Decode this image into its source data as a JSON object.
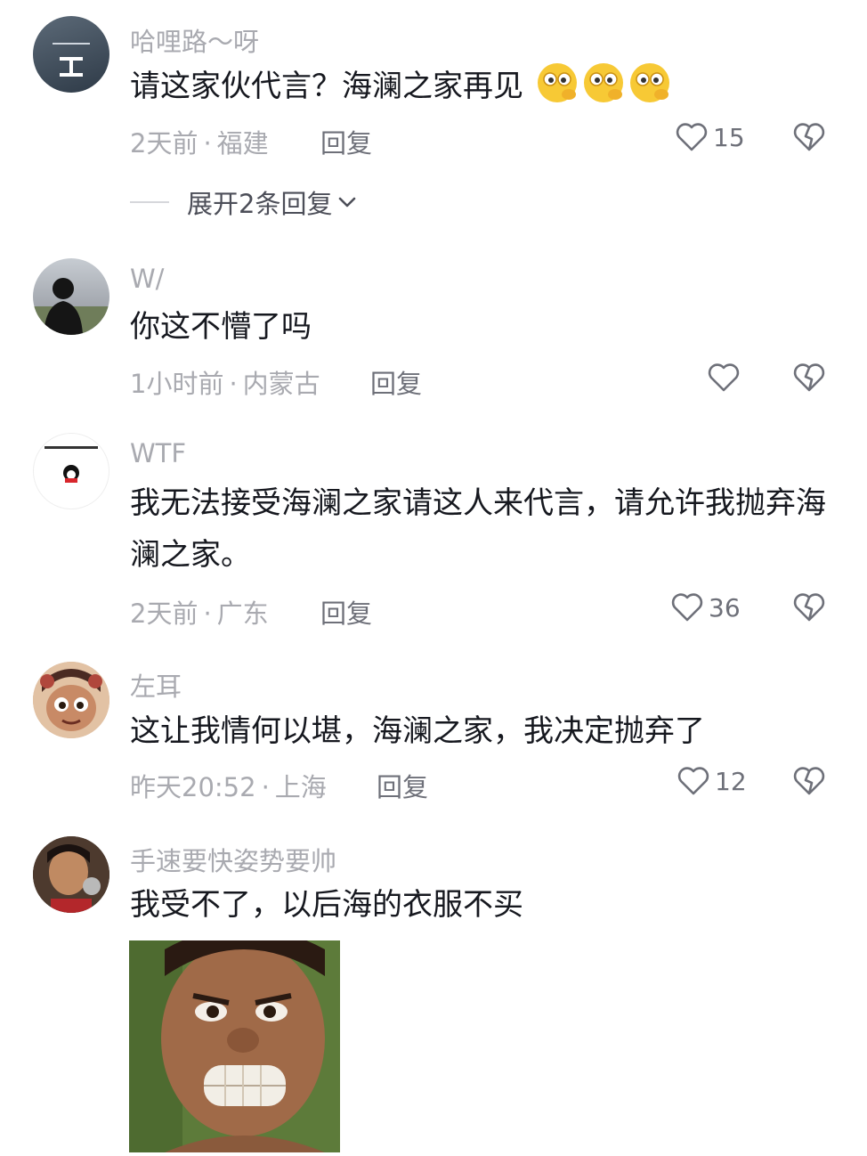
{
  "comments": [
    {
      "username": "哈哩路～呀",
      "text": "请这家伙代言？海澜之家再见",
      "emoji": "😂😂😂",
      "time": "2天前",
      "location": "福建",
      "reply_label": "回复",
      "likes": "15",
      "expand_label": "展开2条回复"
    },
    {
      "username": "W/",
      "text": "你这不懵了吗",
      "time": "1小时前",
      "location": "内蒙古",
      "reply_label": "回复",
      "likes": ""
    },
    {
      "username": "WTF",
      "text": "我无法接受海澜之家请这人来代言，请允许我抛弃海澜之家。",
      "time": "2天前",
      "location": "广东",
      "reply_label": "回复",
      "likes": "36"
    },
    {
      "username": "左耳",
      "text": "这让我情何以堪，海澜之家，我决定抛弃了",
      "time": "昨天20:52",
      "location": "上海",
      "reply_label": "回复",
      "likes": "12"
    },
    {
      "username": "手速要快姿势要帅",
      "text": "我受不了，以后海的衣服不买"
    }
  ],
  "colors": {
    "meta": "#a9aab0",
    "text": "#16181f",
    "icon": "#6e7079"
  },
  "icons": [
    "heart-icon",
    "broken-heart-icon",
    "chevron-down-icon"
  ]
}
